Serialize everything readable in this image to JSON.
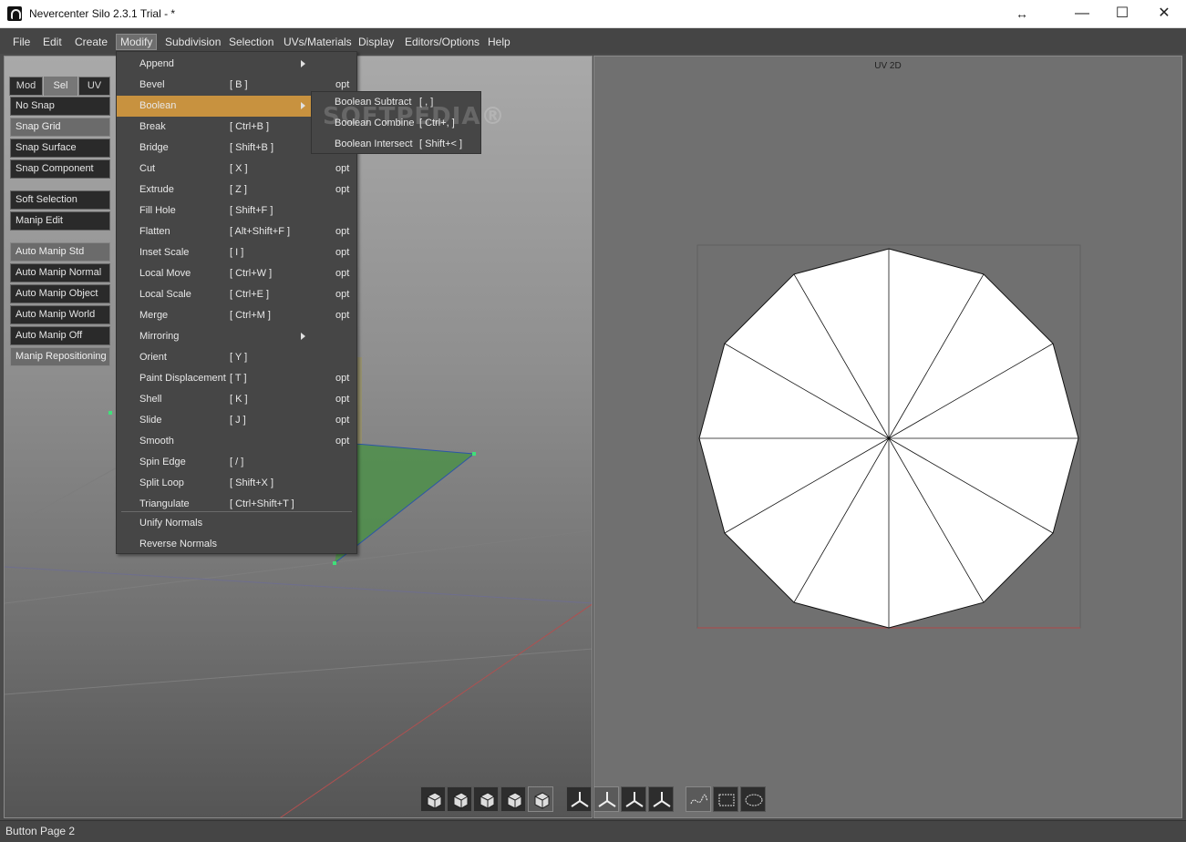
{
  "window": {
    "title": "Nevercenter Silo 2.3.1 Trial - *",
    "resize_glyph": "↔",
    "minimize_glyph": "—",
    "maximize_glyph": "☐",
    "close_glyph": "✕"
  },
  "menubar": {
    "items": [
      "File",
      "Edit",
      "Create",
      "Modify",
      "Subdivision",
      "Selection",
      "UVs/Materials",
      "Display",
      "Editors/Options",
      "Help"
    ],
    "active": "Modify"
  },
  "side_panel": {
    "tabs": [
      "Mod",
      "Sel",
      "UV"
    ],
    "active_tab": "Sel",
    "buttons": [
      {
        "label": "No Snap",
        "active": false
      },
      {
        "label": "Snap Grid",
        "active": true
      },
      {
        "label": "Snap Surface",
        "active": false
      },
      {
        "label": "Snap Component",
        "active": false
      },
      {
        "label": "Soft Selection",
        "active": false
      },
      {
        "label": "Manip Edit",
        "active": false
      },
      {
        "label": "Auto Manip Std",
        "active": true
      },
      {
        "label": "Auto Manip Normal",
        "active": false
      },
      {
        "label": "Auto Manip Object",
        "active": false
      },
      {
        "label": "Auto Manip World",
        "active": false
      },
      {
        "label": "Auto Manip Off",
        "active": false
      },
      {
        "label": "Manip Repositioning",
        "active": true
      }
    ]
  },
  "modify_menu": {
    "items": [
      {
        "label": "Append",
        "shortcut": "",
        "opt": "",
        "submenu": true
      },
      {
        "label": "Bevel",
        "shortcut": "[ B ]",
        "opt": "opt",
        "submenu": false
      },
      {
        "label": "Boolean",
        "shortcut": "",
        "opt": "",
        "submenu": true,
        "highlight": true
      },
      {
        "label": "Break",
        "shortcut": "[ Ctrl+B ]",
        "opt": "",
        "submenu": false
      },
      {
        "label": "Bridge",
        "shortcut": "[ Shift+B ]",
        "opt": "",
        "submenu": false
      },
      {
        "label": "Cut",
        "shortcut": "[ X ]",
        "opt": "opt",
        "submenu": false
      },
      {
        "label": "Extrude",
        "shortcut": "[ Z ]",
        "opt": "opt",
        "submenu": false
      },
      {
        "label": "Fill Hole",
        "shortcut": "[ Shift+F ]",
        "opt": "",
        "submenu": false
      },
      {
        "label": "Flatten",
        "shortcut": "[ Alt+Shift+F ]",
        "opt": "opt",
        "submenu": false
      },
      {
        "label": "Inset Scale",
        "shortcut": "[ I ]",
        "opt": "opt",
        "submenu": false
      },
      {
        "label": "Local Move",
        "shortcut": "[ Ctrl+W ]",
        "opt": "opt",
        "submenu": false
      },
      {
        "label": "Local Scale",
        "shortcut": "[ Ctrl+E ]",
        "opt": "opt",
        "submenu": false
      },
      {
        "label": "Merge",
        "shortcut": "[ Ctrl+M ]",
        "opt": "opt",
        "submenu": false
      },
      {
        "label": "Mirroring",
        "shortcut": "",
        "opt": "",
        "submenu": true
      },
      {
        "label": "Orient",
        "shortcut": "[ Y ]",
        "opt": "",
        "submenu": false
      },
      {
        "label": "Paint Displacement",
        "shortcut": "[ T ]",
        "opt": "opt",
        "submenu": false
      },
      {
        "label": "Shell",
        "shortcut": "[ K ]",
        "opt": "opt",
        "submenu": false
      },
      {
        "label": "Slide",
        "shortcut": "[ J ]",
        "opt": "opt",
        "submenu": false
      },
      {
        "label": "Smooth",
        "shortcut": "",
        "opt": "opt",
        "submenu": false
      },
      {
        "label": "Spin Edge",
        "shortcut": "[ / ]",
        "opt": "",
        "submenu": false
      },
      {
        "label": "Split Loop",
        "shortcut": "[ Shift+X ]",
        "opt": "",
        "submenu": false
      },
      {
        "label": "Triangulate",
        "shortcut": "[ Ctrl+Shift+T ]",
        "opt": "",
        "submenu": false
      }
    ],
    "items_after_separator": [
      {
        "label": "Unify Normals"
      },
      {
        "label": "Reverse Normals"
      }
    ]
  },
  "boolean_submenu": {
    "items": [
      {
        "label": "Boolean Subtract",
        "shortcut": "[ , ]"
      },
      {
        "label": "Boolean Combine",
        "shortcut": "[ Ctrl+, ]"
      },
      {
        "label": "Boolean Intersect",
        "shortcut": "[ Shift+< ]"
      }
    ],
    "watermark": "SOFTPEDIA®"
  },
  "uv_view": {
    "label": "UV 2D",
    "polygon_sides": 12,
    "fill_color": "#ffffff",
    "edge_color": "#111111"
  },
  "bottom_toolbar": {
    "icons": [
      {
        "name": "vertex-select-icon",
        "active": false
      },
      {
        "name": "edge-select-icon",
        "active": false
      },
      {
        "name": "face-select-icon",
        "active": false
      },
      {
        "name": "object-select-icon",
        "active": false
      },
      {
        "name": "multi-select-icon",
        "active": true
      },
      {
        "name": "manip-move-icon",
        "active": false
      },
      {
        "name": "manip-rotate-icon",
        "active": true
      },
      {
        "name": "manip-scale-icon",
        "active": false
      },
      {
        "name": "manip-universal-icon",
        "active": false
      },
      {
        "name": "paint-select-icon",
        "active": true
      },
      {
        "name": "rect-select-icon",
        "active": false
      },
      {
        "name": "lasso-select-icon",
        "active": false
      }
    ]
  },
  "status": {
    "text": "Button Page 2"
  },
  "colors": {
    "menu_highlight": "#c8923f",
    "selection_green": "#4e8f4a"
  }
}
